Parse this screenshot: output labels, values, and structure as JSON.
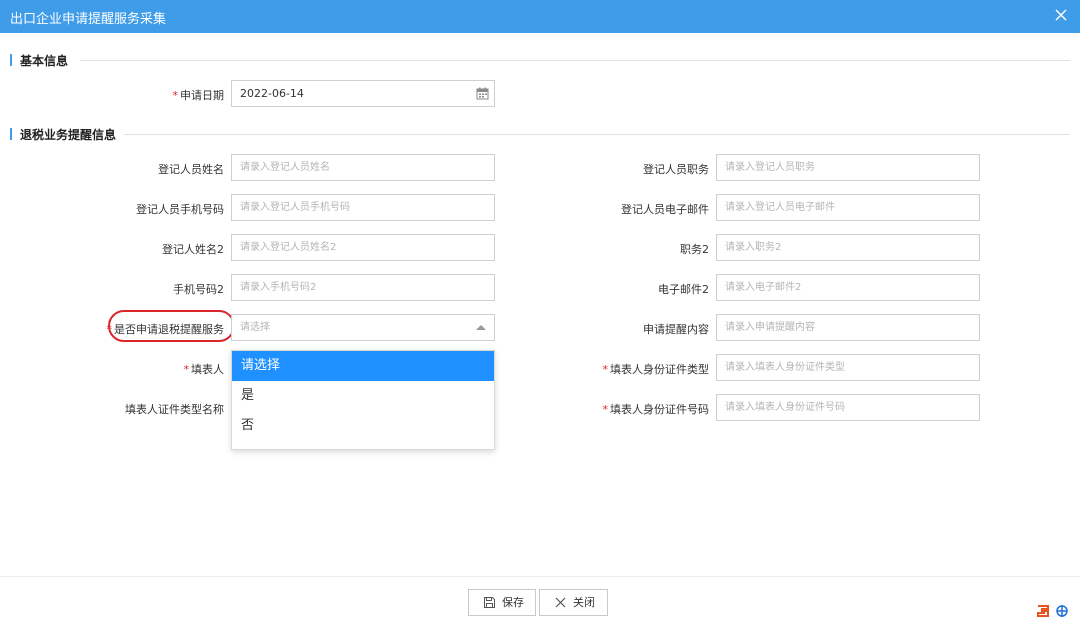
{
  "window": {
    "title": "出口企业申请提醒服务采集"
  },
  "sections": {
    "basic": "基本信息",
    "refund": "退税业务提醒信息"
  },
  "basic": {
    "apply_date_label": "申请日期",
    "apply_date_value": "2022-06-14"
  },
  "form": {
    "reg_name_label": "登记人员姓名",
    "reg_name_ph": "请录入登记人员姓名",
    "reg_job_label": "登记人员职务",
    "reg_job_ph": "请录入登记人员职务",
    "reg_phone_label": "登记人员手机号码",
    "reg_phone_ph": "请录入登记人员手机号码",
    "reg_email_label": "登记人员电子邮件",
    "reg_email_ph": "请录入登记人员电子邮件",
    "reg_name2_label": "登记人姓名2",
    "reg_name2_ph": "请录入登记人员姓名2",
    "job2_label": "职务2",
    "job2_ph": "请录入职务2",
    "phone2_label": "手机号码2",
    "phone2_ph": "请录入手机号码2",
    "email2_label": "电子邮件2",
    "email2_ph": "请录入电子邮件2",
    "apply_service_label": "是否申请退税提醒服务",
    "apply_service_ph": "请选择",
    "remind_content_label": "申请提醒内容",
    "remind_content_ph": "请录入申请提醒内容",
    "filler_label": "填表人",
    "filler_id_type_label": "填表人身份证件类型",
    "filler_id_type_ph": "请录入填表人身份证件类型",
    "filler_cert_name_label": "填表人证件类型名称",
    "filler_id_no_label": "填表人身份证件号码",
    "filler_id_no_ph": "请录入填表人身份证件号码"
  },
  "dropdown": {
    "options": [
      "请选择",
      "是",
      "否"
    ],
    "selected_index": 0
  },
  "footer": {
    "save_label": "保存",
    "close_label": "关闭"
  },
  "colors": {
    "titlebar": "#3f9ce8",
    "selected_option": "#1e90ff",
    "required_star": "#e02020",
    "highlight_ring": "#d9262b"
  }
}
